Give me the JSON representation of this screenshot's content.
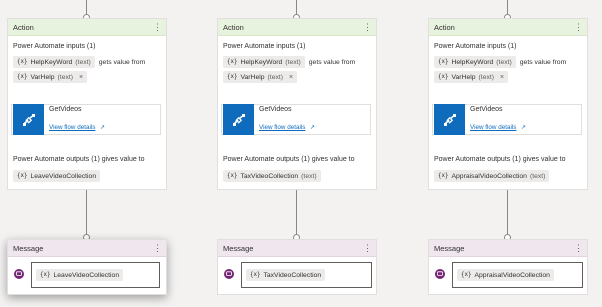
{
  "action_title": "Action",
  "message_title": "Message",
  "more_glyph": "⋮",
  "inputs_label": "Power Automate inputs (1)",
  "input_var": {
    "name": "HelpKeyWord",
    "type": "(text)"
  },
  "gets_value_from": "gets value from",
  "source_var": {
    "name": "VarHelp",
    "type": "(text)"
  },
  "remove_glyph": "×",
  "var_glyph": "{x}",
  "flow_name": "GetVideos",
  "view_flow_details": "View flow details",
  "outputs_label": "Power Automate outputs (1) gives value to",
  "output_type": "(text)",
  "columns": [
    {
      "output_var": "LeaveVideoCollection",
      "message_var": "LeaveVideoCollection"
    },
    {
      "output_var": "TaxVideoCollection",
      "message_var": "TaxVideoCollection"
    },
    {
      "output_var": "AppraisalVideoCollection",
      "message_var": "AppraisalVideoCollection"
    }
  ],
  "colors": {
    "canvas": "#f3f2f1",
    "action_header": "#e8f3df",
    "message_header": "#efe6ee",
    "flow_icon": "#0f6cbd",
    "message_icon": "#742774",
    "link": "#0f6cbd"
  },
  "icons": {
    "flow": "power-automate-flow-icon",
    "message": "chat-message-icon",
    "link": "open-external-icon"
  }
}
